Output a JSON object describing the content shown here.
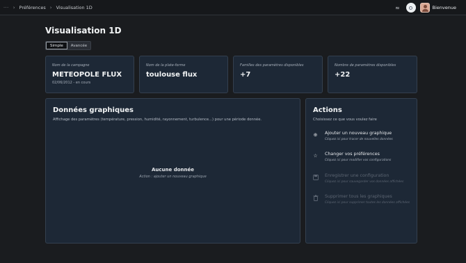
{
  "topbar": {
    "breadcrumb": {
      "more": "···",
      "items": [
        "Préférences",
        "Visualisation 1D"
      ]
    },
    "welcome": "Bienvenue"
  },
  "page": {
    "title": "Visualisation 1D"
  },
  "mode": {
    "options": [
      "Simple",
      "Avancée"
    ],
    "selected": "Simple"
  },
  "info_cards": [
    {
      "label": "Nom de la campagne",
      "value": "METEOPOLE FLUX",
      "sub": "02/06/2012 - en cours"
    },
    {
      "label": "Nom de la plate-forme",
      "value": "toulouse flux"
    },
    {
      "label": "Familles des paramètres disponibles",
      "value": "+7"
    },
    {
      "label": "Nombre de paramètres disponibles",
      "value": "+22"
    }
  ],
  "graph_panel": {
    "title": "Données graphiques",
    "description": "Affichage des paramètres (température, pression, humidité, rayonnement, turbulence...) pour une période donnée.",
    "empty_title": "Aucune donnée",
    "empty_sub": "Action : ajouter un nouveau graphique"
  },
  "actions_panel": {
    "title": "Actions",
    "subtitle": "Choisissez ce que vous voulez faire",
    "items": [
      {
        "icon": "plus-circle-icon",
        "title": "Ajouter un nouveau graphique",
        "sub": "Cliquez ici pour tracer de nouvelles données",
        "enabled": true
      },
      {
        "icon": "star-icon",
        "title": "Changer vos préférences",
        "sub": "Cliquez ici pour modifier vos configurations",
        "enabled": true
      },
      {
        "icon": "save-icon",
        "title": "Enregistrer une configuration",
        "sub": "Cliquez ici pour sauvegarder vos données affichées",
        "enabled": false
      },
      {
        "icon": "trash-icon",
        "title": "Supprimer tous les graphiques",
        "sub": "Cliquez ici pour supprimer toutes les données affichées",
        "enabled": false
      }
    ]
  }
}
